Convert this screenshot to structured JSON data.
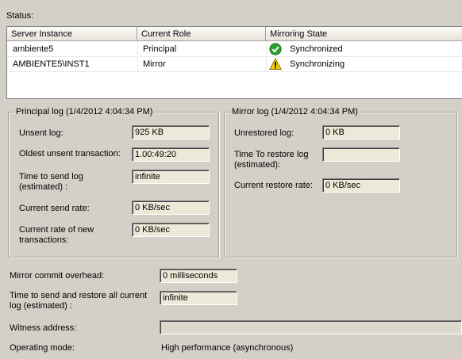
{
  "status_label": "Status:",
  "table": {
    "columns": [
      "Server Instance",
      "Current Role",
      "Mirroring State"
    ],
    "rows": [
      {
        "server": "ambiente5",
        "role": "Principal",
        "state": "Synchronized",
        "state_icon": "check-icon"
      },
      {
        "server": "AMBIENTE5\\INST1",
        "role": "Mirror",
        "state": "Synchronizing",
        "state_icon": "warning-icon"
      }
    ]
  },
  "principal_log": {
    "title": "Principal log (1/4/2012 4:04:34 PM)",
    "unsent_log_label": "Unsent log:",
    "unsent_log_value": "925 KB",
    "oldest_unsent_label": "Oldest unsent transaction:",
    "oldest_unsent_value": "1.00:49:20",
    "time_to_send_label": "Time to send log (estimated) :",
    "time_to_send_value": "infinite",
    "send_rate_label": "Current send rate:",
    "send_rate_value": "0 KB/sec",
    "new_tx_rate_label": "Current rate of new transactions:",
    "new_tx_rate_value": "0 KB/sec"
  },
  "mirror_log": {
    "title": "Mirror log (1/4/2012 4:04:34 PM)",
    "unrestored_label": "Unrestored log:",
    "unrestored_value": "0 KB",
    "time_to_restore_label": "Time To restore log (estimated):",
    "time_to_restore_value": "",
    "restore_rate_label": "Current restore rate:",
    "restore_rate_value": "0 KB/sec"
  },
  "bottom": {
    "commit_overhead_label": "Mirror commit overhead:",
    "commit_overhead_value": "0 milliseconds",
    "send_restore_label": "Time to send and restore all current log (estimated) :",
    "send_restore_value": "infinite",
    "witness_label": "Witness address:",
    "witness_value": "",
    "operating_mode_label": "Operating mode:",
    "operating_mode_value": "High performance (asynchronous)"
  },
  "colors": {
    "ok": "#2e9e2e",
    "warn": "#f5d000",
    "face": "#d4d0c8"
  }
}
